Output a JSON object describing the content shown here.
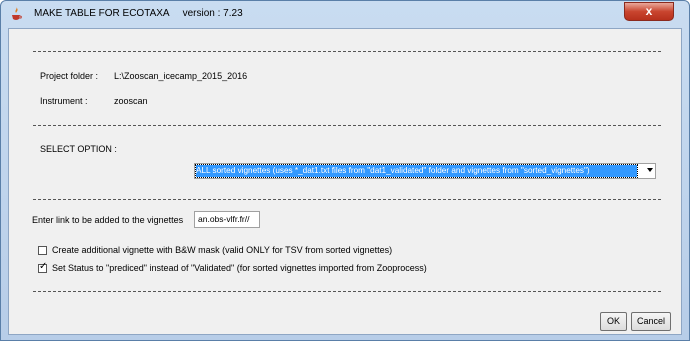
{
  "window": {
    "title": "MAKE TABLE FOR ECOTAXA",
    "version": "version : 7.23",
    "close_label": "x"
  },
  "info": {
    "project_label": "Project folder :",
    "project_value": "L:\\Zooscan_icecamp_2015_2016",
    "instrument_label": "Instrument :",
    "instrument_value": "zooscan"
  },
  "select_option": {
    "label": "SELECT OPTION :",
    "value": "ALL sorted vignettes (uses *_dat1.txt files from \"dat1_validated\" folder and vignettes from \"sorted_vignettes\")"
  },
  "link": {
    "label": "Enter link to be added to the vignettes",
    "value": "an.obs-vlfr.fr//"
  },
  "checkboxes": [
    {
      "label": "Create additional vignette with B&W mask (valid ONLY for TSV from sorted vignettes)",
      "checked": false
    },
    {
      "label": "Set Status to \"prediced\" instead of \"Validated\" (for sorted vignettes imported from Zooprocess)",
      "checked": true
    }
  ],
  "buttons": {
    "ok": "OK",
    "cancel": "Cancel"
  },
  "colors": {
    "selection": "#3399ff",
    "titlebar": "#c9dcf1",
    "close": "#c9452f"
  }
}
